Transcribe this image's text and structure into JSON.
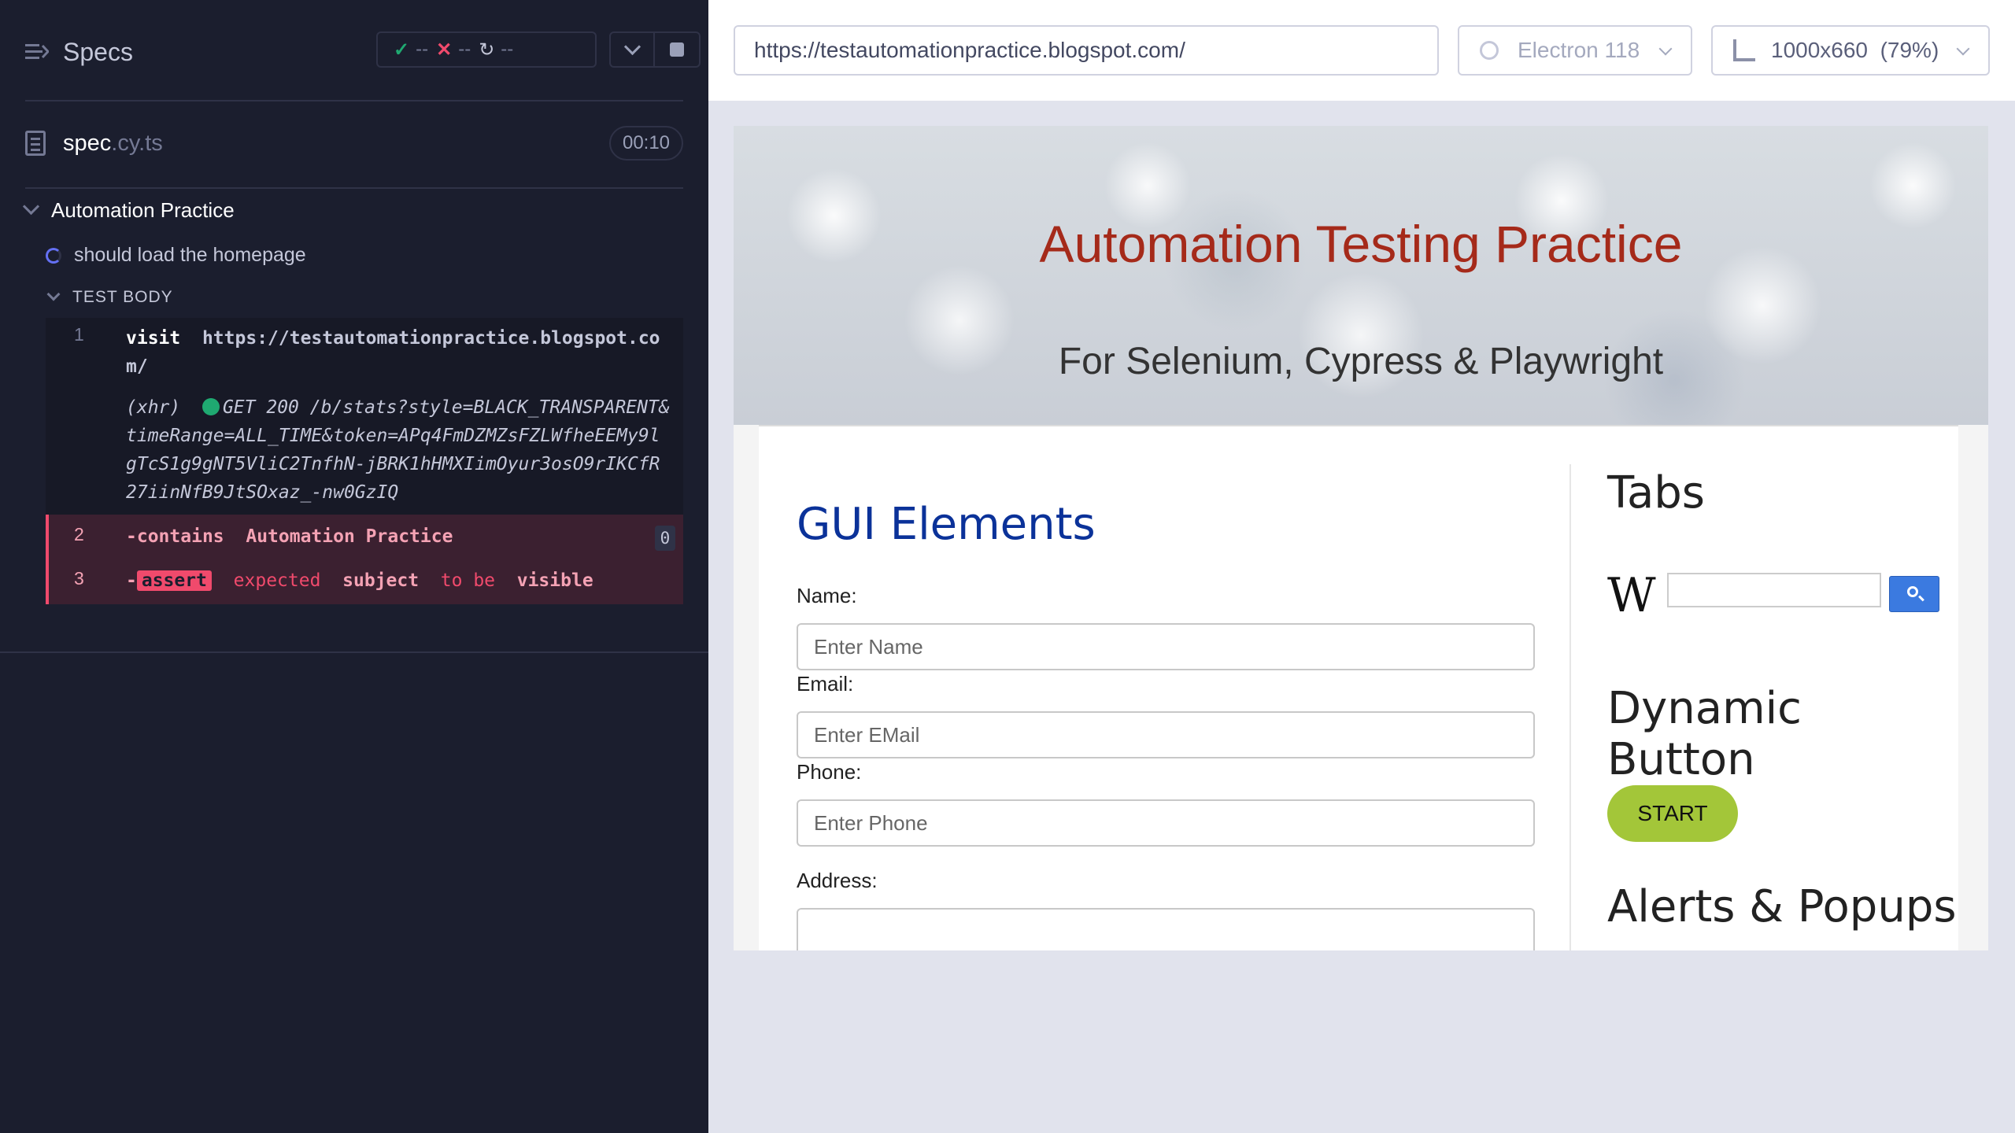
{
  "sidebar": {
    "title": "Specs",
    "stats": {
      "passed": "--",
      "failed": "--",
      "pending": "--"
    },
    "spec_file": {
      "name": "spec",
      "ext": ".cy.ts",
      "duration": "00:10"
    },
    "suite": "Automation Practice",
    "test": "should load the homepage",
    "test_body": "TEST BODY",
    "commands": [
      {
        "num": "1",
        "name": "visit",
        "arg": "https://testautomationpractice.blogspot.com/"
      },
      {
        "xhr_label": "(xhr)",
        "xhr_text": "GET 200 /b/stats?style=BLACK_TRANSPARENT&timeRange=ALL_TIME&token=APq4FmDZMZsFZLWfheEEMy9lgTcS1g9gNT5VliC2TnfhN-jBRK1hHMXIimOyur3osO9rIKCfR27iinNfB9JtSOxaz_-nw0GzIQ"
      },
      {
        "num": "2",
        "prefix": "-",
        "name": "contains",
        "arg": "Automation Practice",
        "count": "0"
      },
      {
        "num": "3",
        "prefix": "-",
        "name": "assert",
        "w1": "expected",
        "w2": "subject",
        "w3": "to be",
        "w4": "visible"
      }
    ]
  },
  "toolbar": {
    "url": "https://testautomationpractice.blogspot.com/",
    "browser": "Electron 118",
    "viewport": "1000x660",
    "scale": "(79%)"
  },
  "aut": {
    "title": "Automation Testing Practice",
    "subtitle": "For Selenium, Cypress & Playwright",
    "gui_title": "GUI Elements",
    "fields": [
      {
        "label": "Name:",
        "placeholder": "Enter Name"
      },
      {
        "label": "Email:",
        "placeholder": "Enter EMail"
      },
      {
        "label": "Phone:",
        "placeholder": "Enter Phone"
      },
      {
        "label": "Address:",
        "placeholder": ""
      }
    ],
    "tabs_title": "Tabs",
    "wiki_logo": "W",
    "dynamic_title": "Dynamic Button",
    "start_label": "START",
    "alerts_title": "Alerts & Popups"
  },
  "colors": {
    "accent_pass": "#1fa971",
    "accent_fail": "#f04a6c",
    "hero_title": "#a52a1a",
    "gui_title": "#0b3299",
    "start_btn": "#a3c639"
  }
}
